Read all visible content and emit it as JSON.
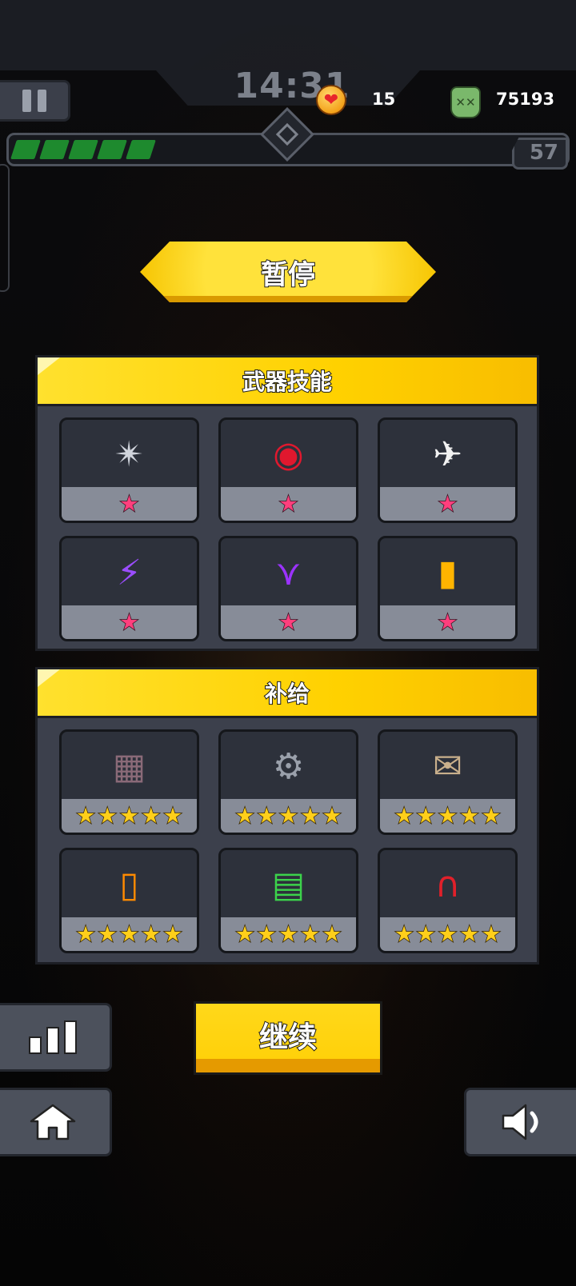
{
  "hud": {
    "timer": "14:31",
    "hearts": "15",
    "kills": "75193",
    "level": "57",
    "xp_fill_segments": 5
  },
  "title": "暂停",
  "weapons": {
    "title": "武器技能",
    "items": [
      {
        "icon": "shuriken-icon",
        "glyph": "✴",
        "color": "#d0d4dc",
        "stars": 1
      },
      {
        "icon": "red-disc-icon",
        "glyph": "◉",
        "color": "#e0182e",
        "stars": 1
      },
      {
        "icon": "drone-icon",
        "glyph": "✈",
        "color": "#f2f2f2",
        "stars": 1
      },
      {
        "icon": "tesla-coil-icon",
        "glyph": "⚡",
        "color": "#9b4dff",
        "stars": 1
      },
      {
        "icon": "purple-boomerang-icon",
        "glyph": "⋎",
        "color": "#9b32ff",
        "stars": 1
      },
      {
        "icon": "grenade-canister-icon",
        "glyph": "▮",
        "color": "#ffb400",
        "stars": 1
      }
    ]
  },
  "supplies": {
    "title": "补给",
    "items": [
      {
        "icon": "armor-vest-icon",
        "glyph": "▦",
        "color": "#8a6a78",
        "stars": 5
      },
      {
        "icon": "mech-arm-icon",
        "glyph": "⚙",
        "color": "#9aa0ab",
        "stars": 5
      },
      {
        "icon": "scroll-icon",
        "glyph": "✉",
        "color": "#c9b08c",
        "stars": 5
      },
      {
        "icon": "battery-icon",
        "glyph": "▯",
        "color": "#ff8a00",
        "stars": 5
      },
      {
        "icon": "power-cell-icon",
        "glyph": "▤",
        "color": "#3cd24b",
        "stars": 5
      },
      {
        "icon": "magnet-icon",
        "glyph": "∩",
        "color": "#e0202a",
        "stars": 5
      }
    ]
  },
  "buttons": {
    "continue": "继续",
    "stats_icon": "bar-chart-icon",
    "home_icon": "home-icon",
    "sound_icon": "speaker-icon"
  },
  "colors": {
    "accent_yellow": "#ffd100",
    "panel_bg": "#3c404c",
    "xp_green": "#1e8a2e"
  }
}
